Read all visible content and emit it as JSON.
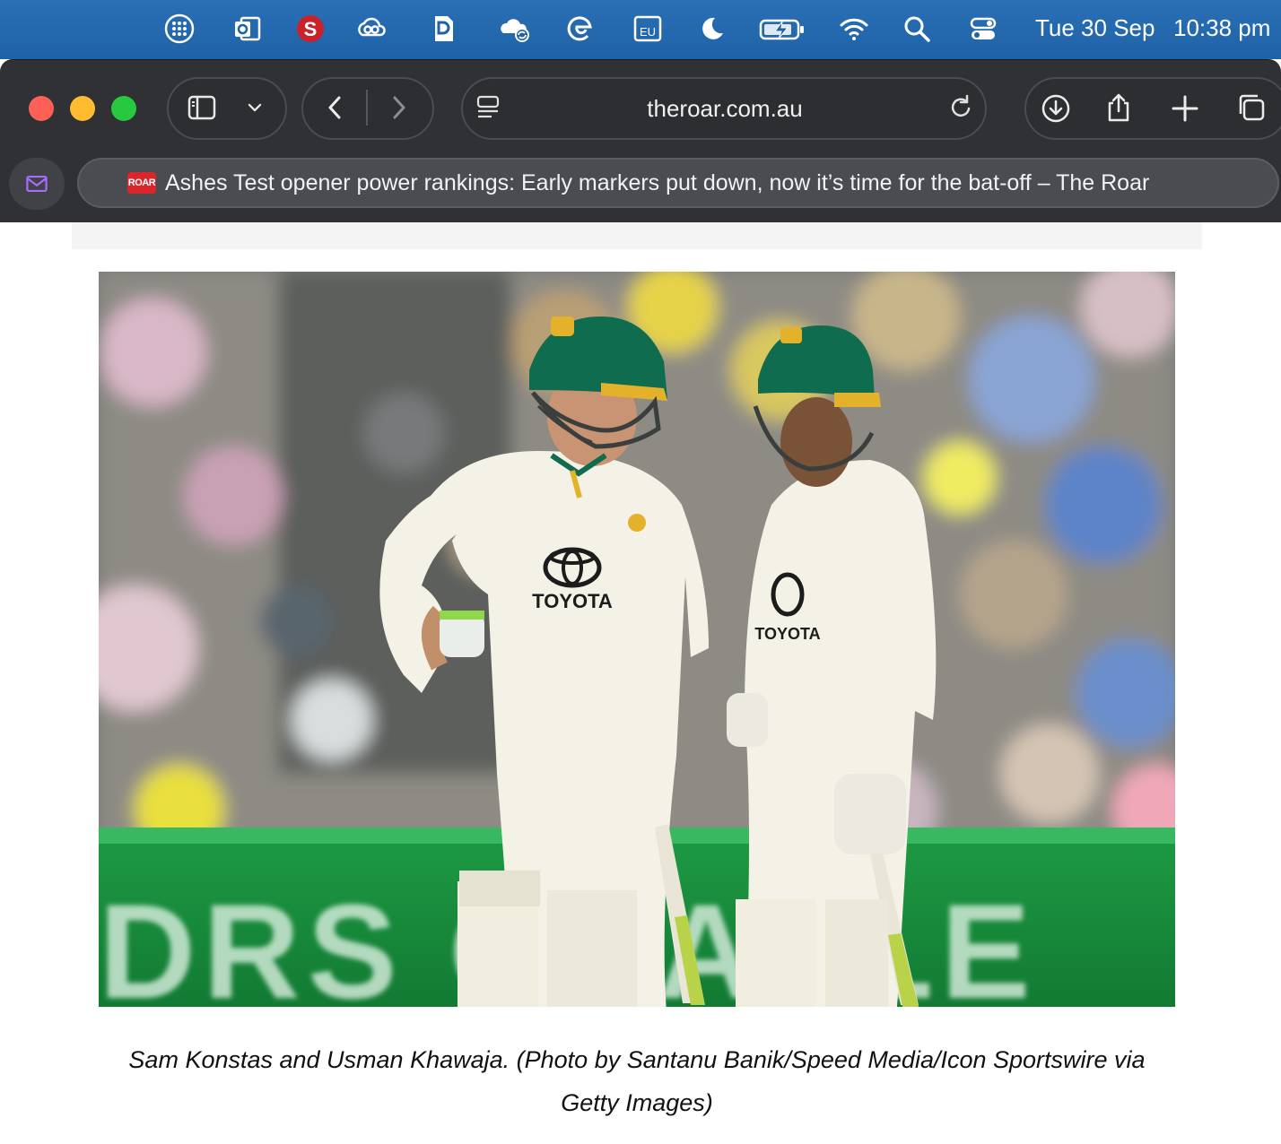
{
  "menubar": {
    "icons": [
      "launchpad-icon",
      "outlook-icon",
      "s-app-icon",
      "creative-cloud-icon",
      "dashlane-icon",
      "onedrive-sync-icon",
      "edge-icon",
      "eu-keyboard-icon",
      "moon-icon",
      "battery-charging-icon",
      "wifi-icon",
      "search-icon",
      "control-center-icon"
    ],
    "eu_label": "EU",
    "date": "Tue 30 Sep",
    "time": "10:38 pm"
  },
  "toolbar": {
    "url": "theroar.com.au"
  },
  "tab": {
    "favicon_text": "ROAR",
    "title": "Ashes Test opener power rankings: Early markers put down, now it’s time for the bat-off – The Roar"
  },
  "article": {
    "caption": "Sam Konstas and Usman Khawaja. (Photo by Santanu Banik/Speed Media/Icon Sportswire via Getty Images)",
    "photo_texts": {
      "jersey_left": "TOYOTA",
      "jersey_right": "TOYOTA",
      "board": "DRS CHALLE"
    }
  },
  "colors": {
    "menubar": "#2368ae",
    "toolbar": "#2f3135",
    "close": "#fe5f57",
    "minimize": "#febc2e",
    "zoom": "#28c840",
    "helmet_green": "#0d6b4f",
    "board_green": "#1aa34a"
  }
}
